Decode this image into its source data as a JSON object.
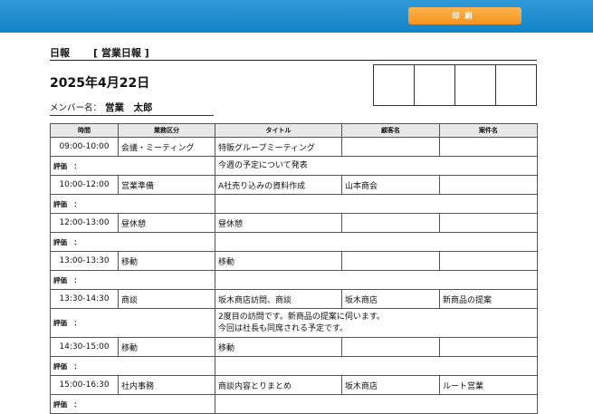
{
  "toolbar": {
    "print_label": "印刷"
  },
  "header": {
    "title": "日報",
    "subtitle": "[ 営業日報 ]"
  },
  "date": "2025年4月22日",
  "member": {
    "label": "メンバー名：",
    "name": "営業　太郎"
  },
  "table": {
    "columns": [
      "時間",
      "業務区分",
      "タイトル",
      "顧客名",
      "案件名"
    ],
    "eval_label": "評価　：",
    "rows": [
      {
        "time": "09:00-10:00",
        "category": "会議・ミーティング",
        "title": "特販グループミーティング",
        "customer": "",
        "project": "",
        "comment": "今週の予定について発表"
      },
      {
        "time": "10:00-12:00",
        "category": "営業準備",
        "title": "A社売り込みの資料作成",
        "customer": "山本商会",
        "project": "",
        "comment": ""
      },
      {
        "time": "12:00-13:00",
        "category": "昼休憩",
        "title": "昼休憩",
        "customer": "",
        "project": "",
        "comment": ""
      },
      {
        "time": "13:00-13:30",
        "category": "移動",
        "title": "移動",
        "customer": "",
        "project": "",
        "comment": ""
      },
      {
        "time": "13:30-14:30",
        "category": "商談",
        "title": "坂木商店訪問、商談",
        "customer": "坂木商店",
        "project": "新商品の提案",
        "comment": "2度目の訪問です。新商品の提案に伺います。\n今回は社長も同席される予定です。"
      },
      {
        "time": "14:30-15:00",
        "category": "移動",
        "title": "移動",
        "customer": "",
        "project": "",
        "comment": ""
      },
      {
        "time": "15:00-16:30",
        "category": "社内事務",
        "title": "商談内容とりまとめ",
        "customer": "坂木商店",
        "project": "ルート営業",
        "comment": ""
      }
    ]
  }
}
